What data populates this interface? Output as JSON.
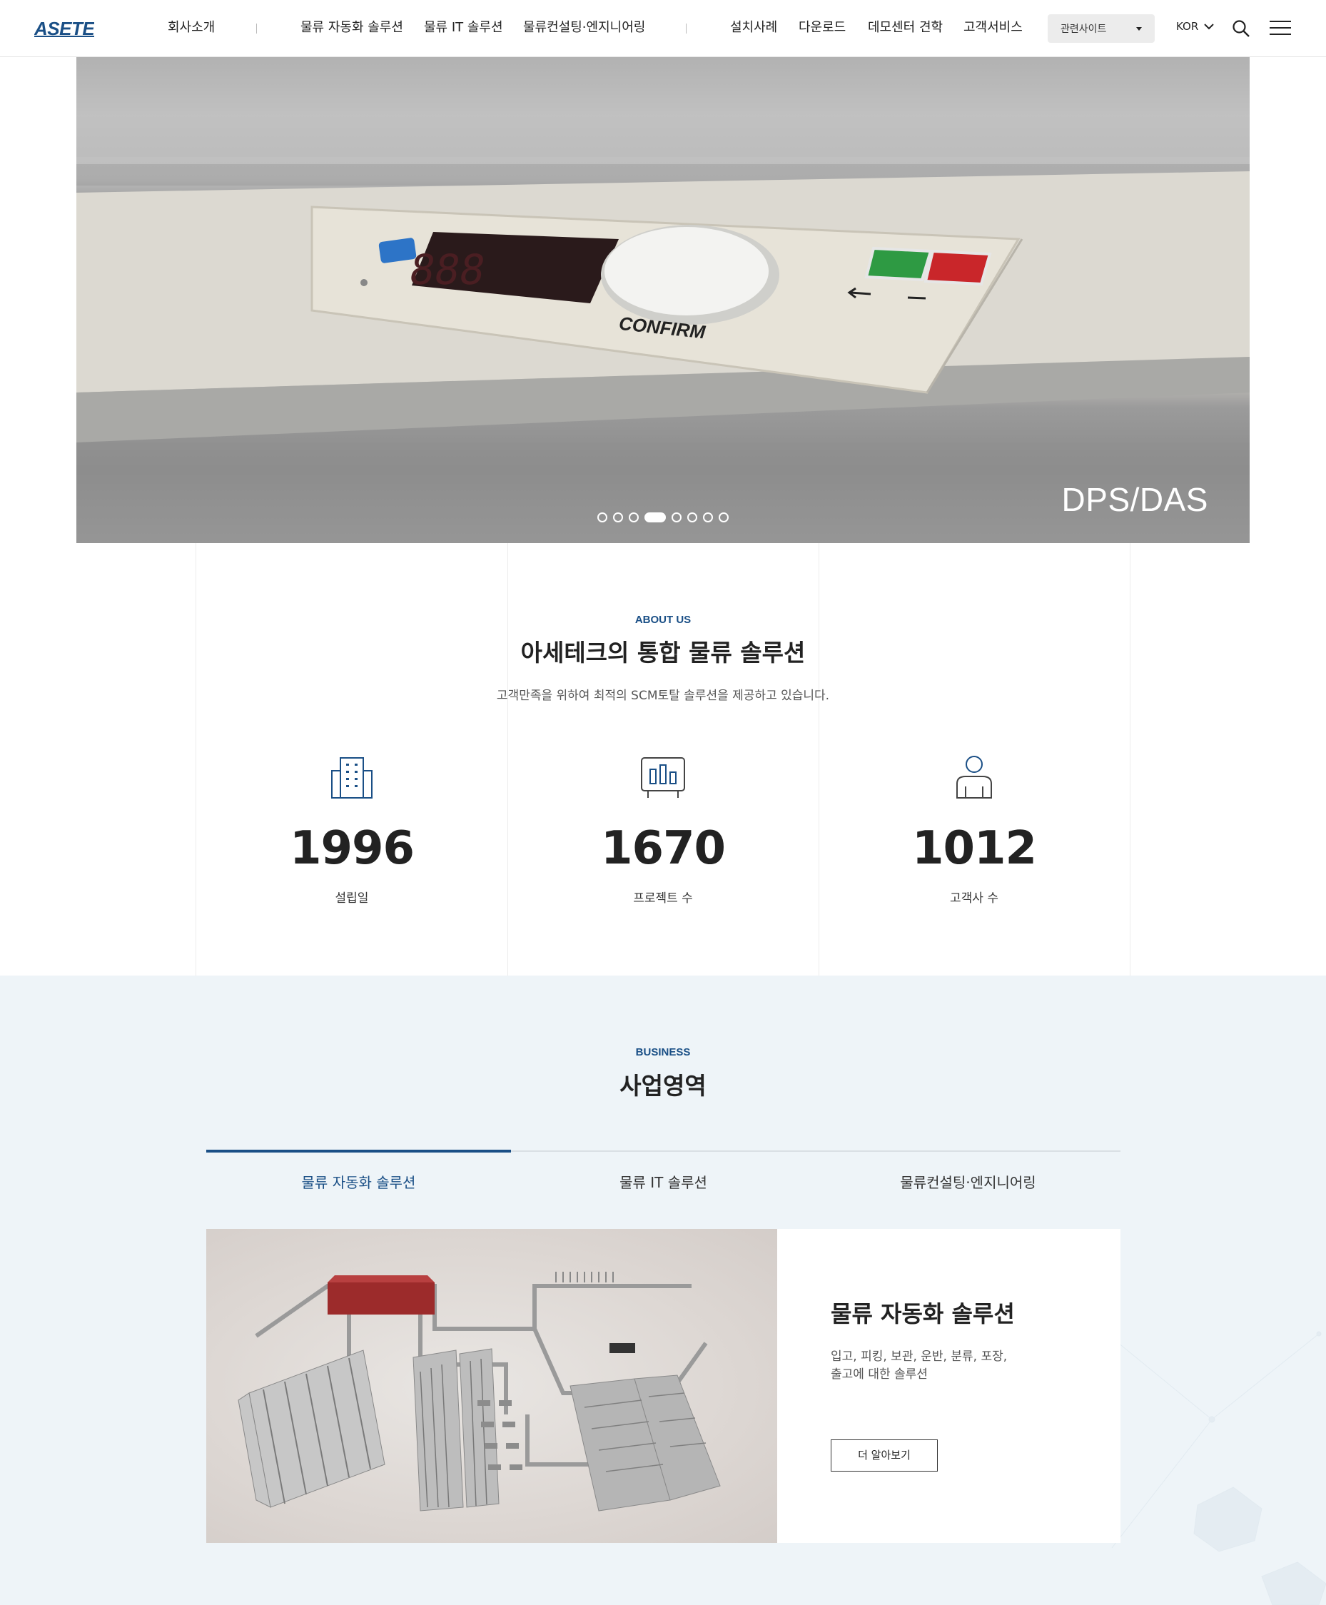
{
  "header": {
    "logo_text": "ASETEC",
    "nav_left": [
      "회사소개"
    ],
    "nav_center": [
      "물류 자동화 솔루션",
      "물류 IT 솔루션",
      "물류컨설팅·엔지니어링"
    ],
    "nav_right": [
      "설치사례",
      "다운로드",
      "데모센터 견학",
      "고객서비스"
    ],
    "family_site": "관련사이트",
    "language": "KOR"
  },
  "hero": {
    "caption": "DPS/DAS",
    "device_label": "CONFIRM",
    "slides_total": 8,
    "active_slide": 4
  },
  "about": {
    "eyebrow": "ABOUT US",
    "title": "아세테크의 통합 물류 솔루션",
    "description": "고객만족을 위하여 최적의 SCM토탈 솔루션을 제공하고 있습니다.",
    "stats": [
      {
        "icon": "building-icon",
        "value": "1996",
        "label": "설립일"
      },
      {
        "icon": "chart-board-icon",
        "value": "1670",
        "label": "프로젝트 수"
      },
      {
        "icon": "person-icon",
        "value": "1012",
        "label": "고객사 수"
      }
    ]
  },
  "business": {
    "eyebrow": "BUSINESS",
    "title": "사업영역",
    "tabs": [
      "물류 자동화 솔루션",
      "물류 IT 솔루션",
      "물류컨설팅·엔지니어링"
    ],
    "active_tab": 0,
    "card": {
      "title": "물류 자동화 솔루션",
      "description": "입고, 피킹, 보관, 운반, 분류, 포장, 출고에 대한 솔루션",
      "button": "더 알아보기"
    }
  },
  "colors": {
    "brand": "#1a4f86",
    "business_bg": "#eef4f8"
  }
}
